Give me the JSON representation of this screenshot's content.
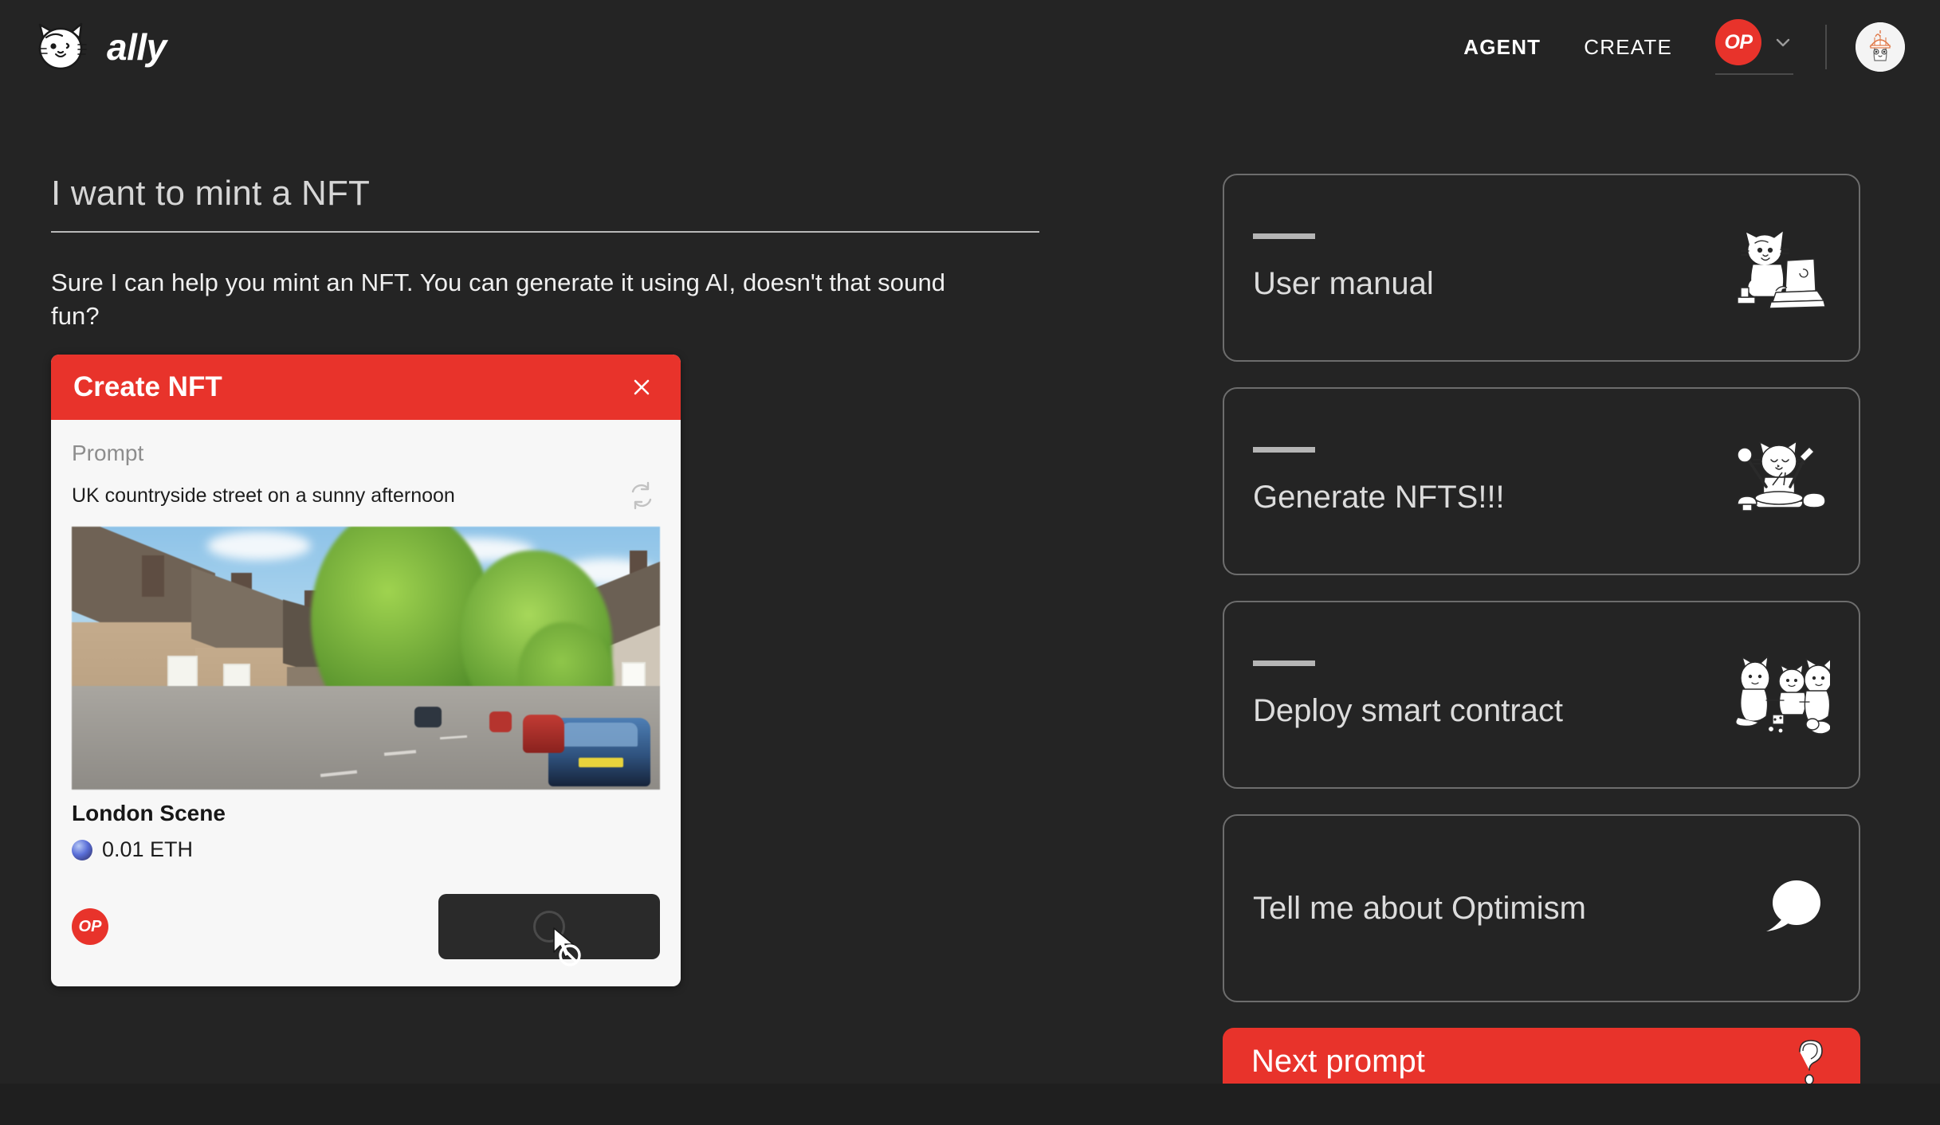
{
  "brand": {
    "name": "ally",
    "logo_icon": "cat-face-logo"
  },
  "nav": {
    "links": [
      {
        "label": "AGENT",
        "active": true
      },
      {
        "label": "CREATE",
        "active": false
      }
    ],
    "chain": {
      "label": "OP",
      "chevron_icon": "chevron-down-icon"
    },
    "avatar_icon": "user-avatar-beanie"
  },
  "conversation": {
    "user_prompt": "I want to mint a NFT",
    "assistant_reply": "Sure I can help you mint an NFT. You can generate it using AI, doesn't that sound fun?"
  },
  "nft_card": {
    "header_title": "Create NFT",
    "close_icon": "close-icon",
    "prompt_label": "Prompt",
    "prompt_value": "UK countryside street on a sunny afternoon",
    "refresh_icon": "refresh-icon",
    "image_alt": "UK countryside street on a sunny afternoon",
    "name": "London Scene",
    "price": "0.01 ETH",
    "chain_badge": "OP",
    "mint_button_label": "",
    "mint_button_state": "loading-disabled",
    "cursor": "not-allowed"
  },
  "suggestions": [
    {
      "title": "User manual",
      "art": "cat-with-laptop"
    },
    {
      "title": "Generate NFTS!!!",
      "art": "cat-cooking"
    },
    {
      "title": "Deploy smart contract",
      "art": "three-cats"
    },
    {
      "title": "Tell me about Optimism",
      "art": "speech-bubble"
    }
  ],
  "next_prompt": {
    "label": "Next prompt",
    "art": "question-mark"
  },
  "colors": {
    "background": "#242424",
    "accent_red": "#E8332B",
    "card_surface": "#F7F7F7",
    "text_primary": "#F0F0F0",
    "text_muted": "#8D8D8D",
    "card_border": "#6D6D6D"
  }
}
